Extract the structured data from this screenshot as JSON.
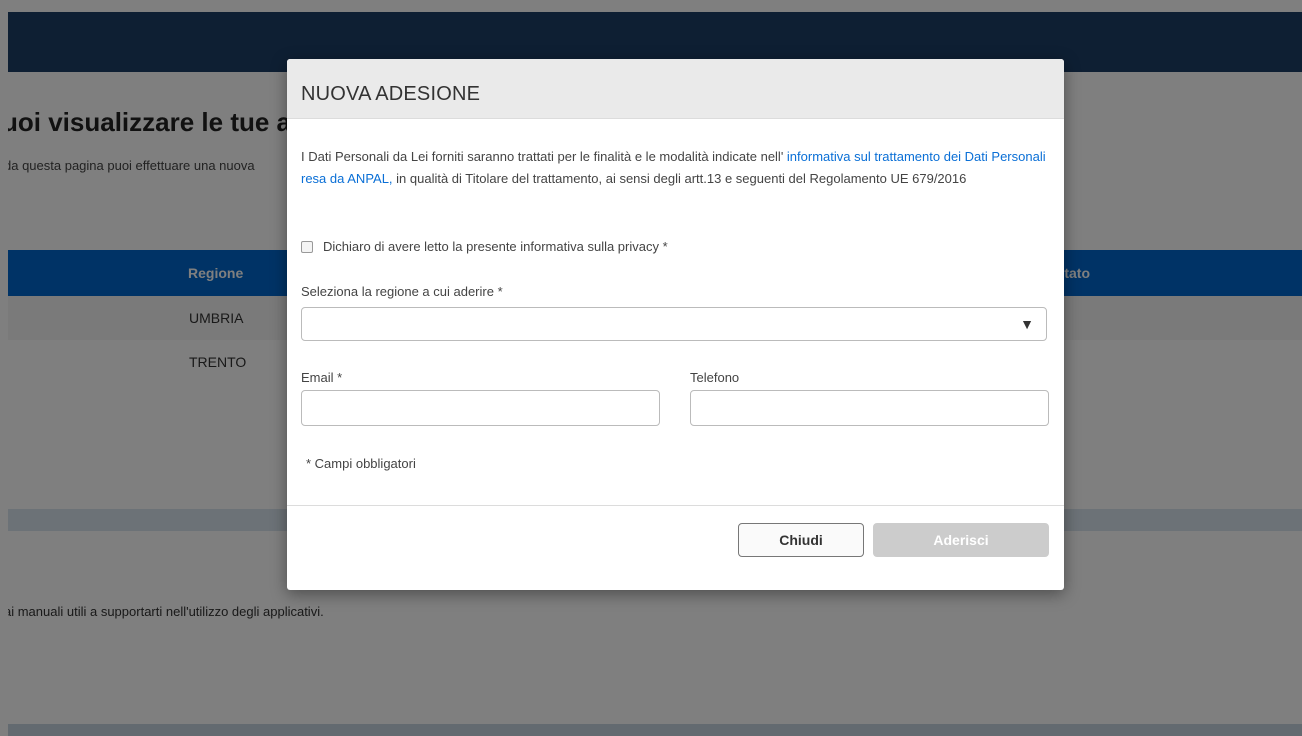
{
  "background_page": {
    "title": "uoi visualizzare le tue ad",
    "subtitle": "da questa pagina puoi effettuare una nuova",
    "table": {
      "headers": [
        "Regione",
        "Stato"
      ],
      "rows": [
        {
          "regione": "UMBRIA"
        },
        {
          "regione": "TRENTO"
        }
      ]
    },
    "manuali_text": "ai manuali utili a supportarti nell'utilizzo degli applicativi."
  },
  "modal": {
    "title": "NUOVA ADESIONE",
    "privacy": {
      "text_before": "I Dati Personali da Lei forniti saranno trattati per le finalità e le modalità indicate nell' ",
      "link_text": "informativa sul trattamento dei Dati Personali resa da ANPAL,",
      "text_after": " in qualità di Titolare del trattamento, ai sensi degli artt.13 e seguenti del Regolamento UE 679/2016"
    },
    "checkbox_label": "Dichiaro di avere letto la presente informativa sulla privacy *",
    "region_label": "Seleziona la regione a cui aderire *",
    "region_value": "",
    "email_label": "Email *",
    "email_value": "",
    "phone_label": "Telefono",
    "phone_value": "",
    "required_note": "* Campi obbligatori",
    "close_label": "Chiudi",
    "submit_label": "Aderisci"
  },
  "colors": {
    "topbar": "#1c3e66",
    "table_header": "#0067cc",
    "link": "#0a6fd6",
    "disabled_button": "#cccccc"
  }
}
